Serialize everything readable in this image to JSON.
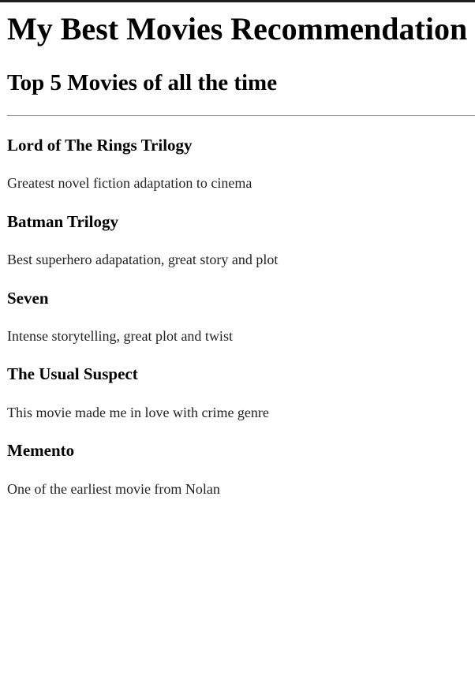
{
  "page": {
    "title": "My Best Movies Recommendation",
    "subtitle": "Top 5 Movies of all the time"
  },
  "movies": [
    {
      "title": "Lord of The Rings Trilogy",
      "description": "Greatest novel fiction adaptation to cinema"
    },
    {
      "title": "Batman Trilogy",
      "description": "Best superhero adapatation, great story and plot"
    },
    {
      "title": "Seven",
      "description": "Intense storytelling, great plot and twist"
    },
    {
      "title": "The Usual Suspect",
      "description": "This movie made me in love with crime genre"
    },
    {
      "title": "Memento",
      "description": "One of the earliest movie from Nolan"
    }
  ]
}
